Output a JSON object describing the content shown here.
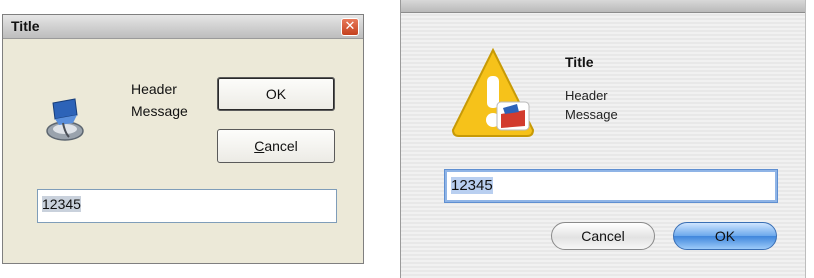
{
  "windows_dialog": {
    "title": "Title",
    "close_glyph": "✕",
    "icon": "installer-icon",
    "header": "Header",
    "message": "Message",
    "ok_label": "OK",
    "cancel_label_mnemonic": "C",
    "cancel_label_rest": "ancel",
    "input_value": "12345"
  },
  "mac_dialog": {
    "icon": "caution-installer-icon",
    "title": "Title",
    "header": "Header",
    "message": "Message",
    "input_value": "12345",
    "cancel_label": "Cancel",
    "ok_label": "OK"
  },
  "colors": {
    "xp_face": "#ece9d8",
    "xp_close": "#c4411d",
    "aqua_default_button": "#3f86dc",
    "caution_yellow": "#f6c21a"
  }
}
